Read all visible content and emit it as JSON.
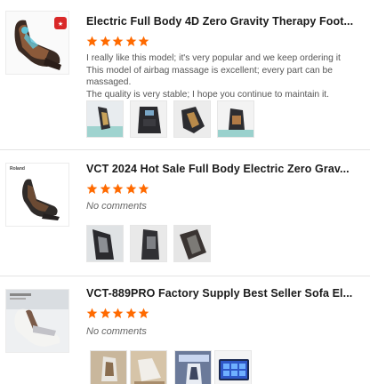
{
  "colors": {
    "star": "#ff6a00",
    "title": "#1a1a1a",
    "comment": "#555555",
    "divider": "#e3e3e3"
  },
  "reviews": [
    {
      "title": "Electric Full Body 4D Zero Gravity Therapy Foot...",
      "rating": 5,
      "comment_lines": [
        "I really like this model; it's very popular and we keep ordering it",
        "This model of airbag massage is excellent; every part can be massaged.",
        "The quality is very stable; I hope you continue to maintain it."
      ],
      "photo_count": 4
    },
    {
      "title": "VCT 2024 Hot Sale Full Body Electric Zero Grav...",
      "rating": 5,
      "thumb_brand": "Roland",
      "no_comment": "No comments",
      "photo_count": 3
    },
    {
      "title": "VCT-889PRO Factory Supply Best Seller Sofa El...",
      "rating": 5,
      "no_comment": "No comments",
      "photo_count": 4
    }
  ]
}
